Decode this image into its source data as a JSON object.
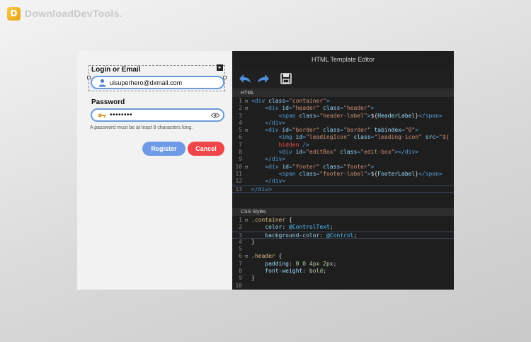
{
  "watermark": {
    "logo_letter": "D",
    "text": "DownloadDevTools."
  },
  "form": {
    "login_label": "Login or Email",
    "email_value": "uisuperhero@dxmail.com",
    "password_label": "Password",
    "password_value": "••••••••",
    "hint": "A password must be at least 8 characters long.",
    "register_label": "Register",
    "cancel_label": "Cancel"
  },
  "editor": {
    "title": "HTML Template Editor",
    "html_section": "HTML",
    "css_section": "CSS Styles",
    "html_lines": [
      {
        "n": "1",
        "fold": "⊟",
        "parts": [
          [
            "t-tag",
            "<div "
          ],
          [
            "t-attr",
            "class"
          ],
          [
            "t-tag",
            "="
          ],
          [
            "t-str",
            "\"container\""
          ],
          [
            "t-tag",
            ">"
          ]
        ]
      },
      {
        "n": "2",
        "fold": "⊟",
        "parts": [
          [
            "",
            "    "
          ],
          [
            "t-tag",
            "<div "
          ],
          [
            "t-attr",
            "id"
          ],
          [
            "t-tag",
            "="
          ],
          [
            "t-str",
            "\"header\""
          ],
          [
            "t-attr",
            " class"
          ],
          [
            "t-tag",
            "="
          ],
          [
            "t-str",
            "\"header\""
          ],
          [
            "t-tag",
            ">"
          ]
        ]
      },
      {
        "n": "3",
        "fold": "",
        "parts": [
          [
            "",
            "        "
          ],
          [
            "t-tag",
            "<span "
          ],
          [
            "t-attr",
            "class"
          ],
          [
            "t-tag",
            "="
          ],
          [
            "t-str",
            "\"header-label\""
          ],
          [
            "t-tag",
            ">"
          ],
          [
            "",
            "${"
          ],
          [
            "t-attr",
            "HeaderLabel"
          ],
          [
            "",
            "}"
          ],
          [
            "t-tag",
            "</span>"
          ]
        ]
      },
      {
        "n": "4",
        "fold": "",
        "parts": [
          [
            "",
            "    "
          ],
          [
            "t-tag",
            "</div>"
          ]
        ]
      },
      {
        "n": "5",
        "fold": "⊟",
        "parts": [
          [
            "",
            "    "
          ],
          [
            "t-tag",
            "<div "
          ],
          [
            "t-attr",
            "id"
          ],
          [
            "t-tag",
            "="
          ],
          [
            "t-str",
            "\"border\""
          ],
          [
            "t-attr",
            " class"
          ],
          [
            "t-tag",
            "="
          ],
          [
            "t-str",
            "\"border\""
          ],
          [
            "t-attr",
            " tabindex"
          ],
          [
            "t-tag",
            "="
          ],
          [
            "t-str",
            "\"0\""
          ],
          [
            "t-tag",
            ">"
          ]
        ]
      },
      {
        "n": "6",
        "fold": "",
        "parts": [
          [
            "",
            "        "
          ],
          [
            "t-tag",
            "<img "
          ],
          [
            "t-attr",
            "id"
          ],
          [
            "t-tag",
            "="
          ],
          [
            "t-str",
            "\"leadingIcon\""
          ],
          [
            "t-attr",
            " class"
          ],
          [
            "t-tag",
            "="
          ],
          [
            "t-str",
            "\"leading-icon\""
          ],
          [
            "t-attr",
            " src"
          ],
          [
            "t-tag",
            "="
          ],
          [
            "t-str",
            "\"${"
          ]
        ]
      },
      {
        "n": "7",
        "fold": "",
        "parts": [
          [
            "",
            "        "
          ],
          [
            "t-red",
            "hidden"
          ],
          [
            "t-tag",
            " />"
          ]
        ]
      },
      {
        "n": "8",
        "fold": "",
        "parts": [
          [
            "",
            "        "
          ],
          [
            "t-tag",
            "<div "
          ],
          [
            "t-attr",
            "id"
          ],
          [
            "t-tag",
            "="
          ],
          [
            "t-str",
            "\"editBox\""
          ],
          [
            "t-attr",
            " class"
          ],
          [
            "t-tag",
            "="
          ],
          [
            "t-str",
            "\"edit-box\""
          ],
          [
            "t-tag",
            "></div>"
          ]
        ]
      },
      {
        "n": "9",
        "fold": "",
        "parts": [
          [
            "",
            "    "
          ],
          [
            "t-tag",
            "</div>"
          ]
        ]
      },
      {
        "n": "10",
        "fold": "⊟",
        "parts": [
          [
            "",
            "    "
          ],
          [
            "t-tag",
            "<div "
          ],
          [
            "t-attr",
            "id"
          ],
          [
            "t-tag",
            "="
          ],
          [
            "t-str",
            "\"footer\""
          ],
          [
            "t-attr",
            " class"
          ],
          [
            "t-tag",
            "="
          ],
          [
            "t-str",
            "\"footer\""
          ],
          [
            "t-tag",
            ">"
          ]
        ]
      },
      {
        "n": "11",
        "fold": "",
        "parts": [
          [
            "",
            "        "
          ],
          [
            "t-tag",
            "<span "
          ],
          [
            "t-attr",
            "class"
          ],
          [
            "t-tag",
            "="
          ],
          [
            "t-str",
            "\"footer-label\""
          ],
          [
            "t-tag",
            ">"
          ],
          [
            "",
            "${"
          ],
          [
            "t-attr",
            "FooterLabel"
          ],
          [
            "",
            "}"
          ],
          [
            "t-tag",
            "</span>"
          ]
        ]
      },
      {
        "n": "12",
        "fold": "",
        "parts": [
          [
            "",
            "    "
          ],
          [
            "t-tag",
            "</div>"
          ]
        ]
      },
      {
        "n": "13",
        "fold": "",
        "cur": true,
        "parts": [
          [
            "t-tag",
            "</div>"
          ]
        ]
      }
    ],
    "css_lines": [
      {
        "n": "1",
        "fold": "⊟",
        "parts": [
          [
            "t-sel",
            ".container"
          ],
          [
            "",
            " {"
          ]
        ]
      },
      {
        "n": "2",
        "fold": "",
        "parts": [
          [
            "",
            "    "
          ],
          [
            "t-prop",
            "color"
          ],
          [
            "",
            ": "
          ],
          [
            "t-at",
            "@ControlText"
          ],
          [
            "",
            ";"
          ]
        ]
      },
      {
        "n": "3",
        "fold": "",
        "cur": true,
        "parts": [
          [
            "",
            "    "
          ],
          [
            "t-prop",
            "background-color"
          ],
          [
            "",
            ": "
          ],
          [
            "t-at",
            "@Control"
          ],
          [
            "",
            ";"
          ]
        ]
      },
      {
        "n": "4",
        "fold": "",
        "parts": [
          [
            "",
            "}"
          ]
        ]
      },
      {
        "n": "5",
        "fold": "",
        "parts": []
      },
      {
        "n": "6",
        "fold": "⊟",
        "parts": [
          [
            "t-sel",
            ".header"
          ],
          [
            "",
            " {"
          ]
        ]
      },
      {
        "n": "7",
        "fold": "",
        "parts": [
          [
            "",
            "    "
          ],
          [
            "t-prop",
            "padding"
          ],
          [
            "",
            ": "
          ],
          [
            "t-val",
            "0 0 4px 2px"
          ],
          [
            "",
            ";"
          ]
        ]
      },
      {
        "n": "8",
        "fold": "",
        "parts": [
          [
            "",
            "    "
          ],
          [
            "t-prop",
            "font-weight"
          ],
          [
            "",
            ": "
          ],
          [
            "t-val",
            "bold"
          ],
          [
            "",
            ";"
          ]
        ]
      },
      {
        "n": "9",
        "fold": "",
        "parts": [
          [
            "",
            "}"
          ]
        ]
      },
      {
        "n": "10",
        "fold": "",
        "parts": []
      }
    ]
  }
}
